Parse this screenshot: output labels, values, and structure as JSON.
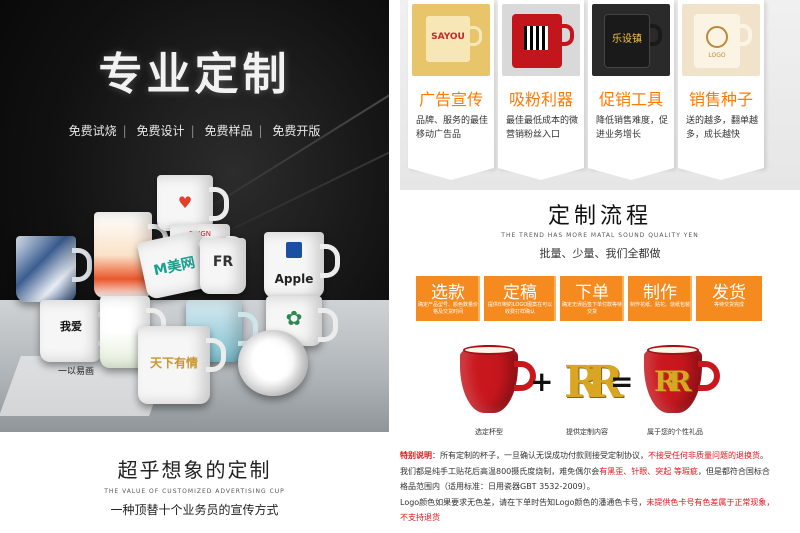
{
  "left": {
    "hero_title": "专业定制",
    "hero_tags": [
      "免费试烧",
      "免费设计",
      "免费样品",
      "免费开版"
    ],
    "mug_labels": {
      "apple": "Apple",
      "mei": "M美网",
      "reign": "REIGN",
      "love": "我爱",
      "yi": "一以易画",
      "gold": "天下有情"
    },
    "section_title": "超乎想象的定制",
    "section_en": "THE VALUE OF CUSTOMIZED ADVERTISING CUP",
    "section_tagline": "一种顶替十个业务员的宣传方式"
  },
  "right": {
    "cards": [
      {
        "caption": "广告宣传",
        "desc": "品牌、服务的最佳移动广告品",
        "img_text": "SAYOU"
      },
      {
        "caption": "吸粉利器",
        "desc": "最佳最低成本的微营销粉丝入口",
        "img_text": "QR"
      },
      {
        "caption": "促销工具",
        "desc": "降低销售难度，促进业务增长",
        "img_text": "乐设镇"
      },
      {
        "caption": "销售种子",
        "desc": "送的越多，翻单越多，成长越快",
        "img_text": "LOGO"
      }
    ],
    "process_title": "定制流程",
    "process_en": "THE TREND HAS MORE MATAL SOUND QUALITY YEN",
    "process_sub": "批量、少量、我们全都做",
    "steps": [
      {
        "label": "选款",
        "desc": "确定产品型号、颜色数量价格及交货时间"
      },
      {
        "label": "定稿",
        "desc": "提供印制的LOGO图案在可以收费打样确认"
      },
      {
        "label": "下单",
        "desc": "确定无误后签下单付款等待交货"
      },
      {
        "label": "制作",
        "desc": "制作花纸、贴花、烧纸包装"
      },
      {
        "label": "发货",
        "desc": "等待交货完成"
      }
    ],
    "combo": {
      "cap_cup": "选定杯型",
      "cap_logo": "提供定制内容",
      "cap_result": "属于您的个性礼品",
      "plus": "+",
      "equals": "=",
      "logo_glyph": "R"
    },
    "notes": {
      "label": "特别说明",
      "line1_a": "：所有定制的杯子，一旦确认无误成功付款则接受定制协议，",
      "line1_red": "不接受任何非质量问题的退换货",
      "line1_b": "。",
      "line2_a": "我们都是纯手工贴花后高温800摄氏度烧制，难免偶尔会",
      "line2_red": "有黑歪、针眼、突起 等瑕疵",
      "line2_b": "，但是都符合国标合",
      "line3": "格品范围内（适用标准：日用瓷器GBT 3532-2009）。",
      "line4_a": "Logo颜色如果要求无色差，请在下单时告知Logo颜色的潘通色卡号，",
      "line4_red": "未提供色卡号有色差属于正常现象，",
      "line5_red": "不支持退货"
    }
  }
}
